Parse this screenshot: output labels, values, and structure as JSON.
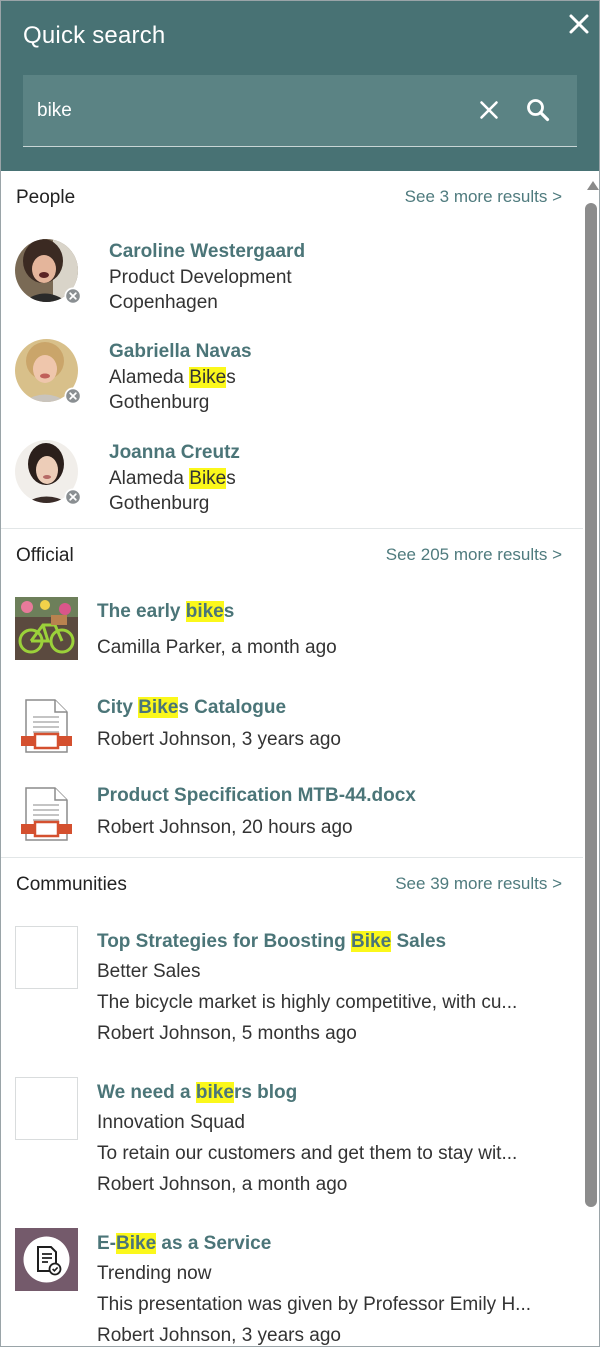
{
  "header": {
    "title": "Quick search",
    "close_icon": "close-icon"
  },
  "search": {
    "value": "bike",
    "clear_icon": "clear-icon",
    "search_icon": "search-icon"
  },
  "colors": {
    "header_bg": "#487274",
    "search_bg": "#5b8384",
    "link": "#4b7578",
    "highlight": "#fbf81b"
  },
  "people": {
    "title": "People",
    "more": "See 3 more results >",
    "items": [
      {
        "name": "Caroline Westergaard",
        "line1_pre": "Product Development",
        "line1_hl": "",
        "line1_post": "",
        "line2": "Copenhagen",
        "status_icon": "offline-status-icon"
      },
      {
        "name": "Gabriella Navas",
        "line1_pre": "Alameda ",
        "line1_hl": "Bike",
        "line1_post": "s",
        "line2": "Gothenburg",
        "status_icon": "offline-status-icon"
      },
      {
        "name": "Joanna Creutz",
        "line1_pre": "Alameda ",
        "line1_hl": "Bike",
        "line1_post": "s",
        "line2": "Gothenburg",
        "status_icon": "offline-status-icon"
      }
    ]
  },
  "official": {
    "title": "Official",
    "more": "See 205 more results >",
    "items": [
      {
        "title_pre": "The early ",
        "title_hl": "bike",
        "title_post": "s",
        "meta": "Camilla Parker, a month ago",
        "thumb": "bike-photo"
      },
      {
        "title_pre": "City ",
        "title_hl": "Bike",
        "title_post": "s Catalogue",
        "meta": "Robert Johnson, 3 years ago",
        "thumb": "presentation-file-icon"
      },
      {
        "title_pre": "Product Specification MTB-44.docx",
        "title_hl": "",
        "title_post": "",
        "meta": "Robert Johnson, 20 hours ago",
        "thumb": "presentation-file-icon"
      }
    ]
  },
  "communities": {
    "title": "Communities",
    "more": "See 39 more results >",
    "items": [
      {
        "title_pre": "Top Strategies for Boosting ",
        "title_hl": "Bike",
        "title_post": " Sales",
        "community": "Better Sales",
        "excerpt": "The bicycle market is highly competitive, with cu...",
        "meta": "Robert Johnson, 5 months ago",
        "thumb": "blank-thumbnail"
      },
      {
        "title_pre": "We need a ",
        "title_hl": "bike",
        "title_post": "rs blog",
        "community": "Innovation Squad",
        "excerpt": "To retain our customers and get them to stay wit...",
        "meta": "Robert Johnson, a month ago",
        "thumb": "blank-thumbnail"
      },
      {
        "title_pre": "E-",
        "title_hl": "Bike",
        "title_post": " as a Service",
        "community": "Trending now",
        "excerpt": "This presentation was given by Professor Emily H...",
        "meta": "Robert Johnson, 3 years ago",
        "thumb": "document-check-icon"
      }
    ]
  }
}
